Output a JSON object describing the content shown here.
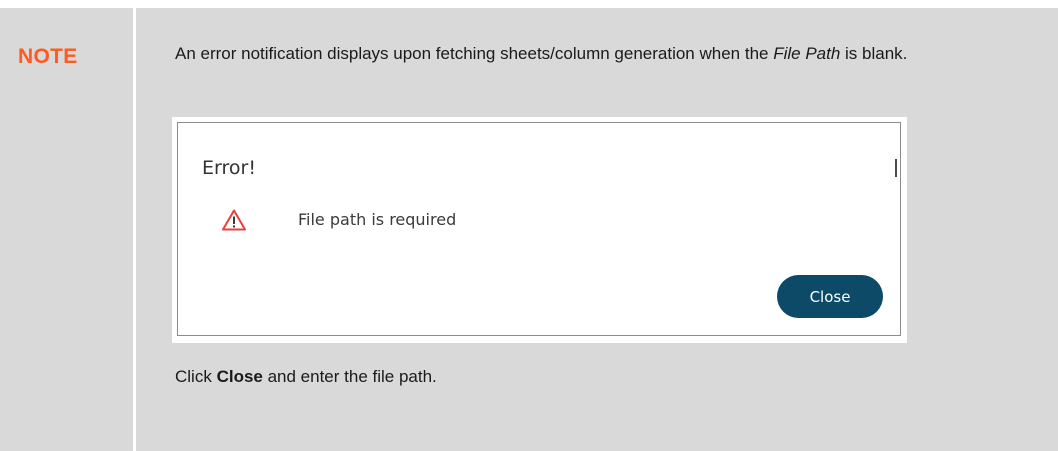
{
  "note": {
    "label": "NOTE",
    "text_before": "An error notification displays upon fetching sheets/column generation when the ",
    "text_emphasis": "File Path",
    "text_after": " is blank."
  },
  "dialog": {
    "title": "Error!",
    "icon": "warning-triangle-icon",
    "message": "File path is required",
    "close_label": "Close",
    "button_color": "#0c4a68",
    "icon_color": "#e8413c"
  },
  "instruction": {
    "prefix": "Click ",
    "bold": "Close",
    "suffix": " and enter the file path."
  },
  "colors": {
    "note_label": "#ff5a1f",
    "note_background": "#d9d9d9"
  }
}
